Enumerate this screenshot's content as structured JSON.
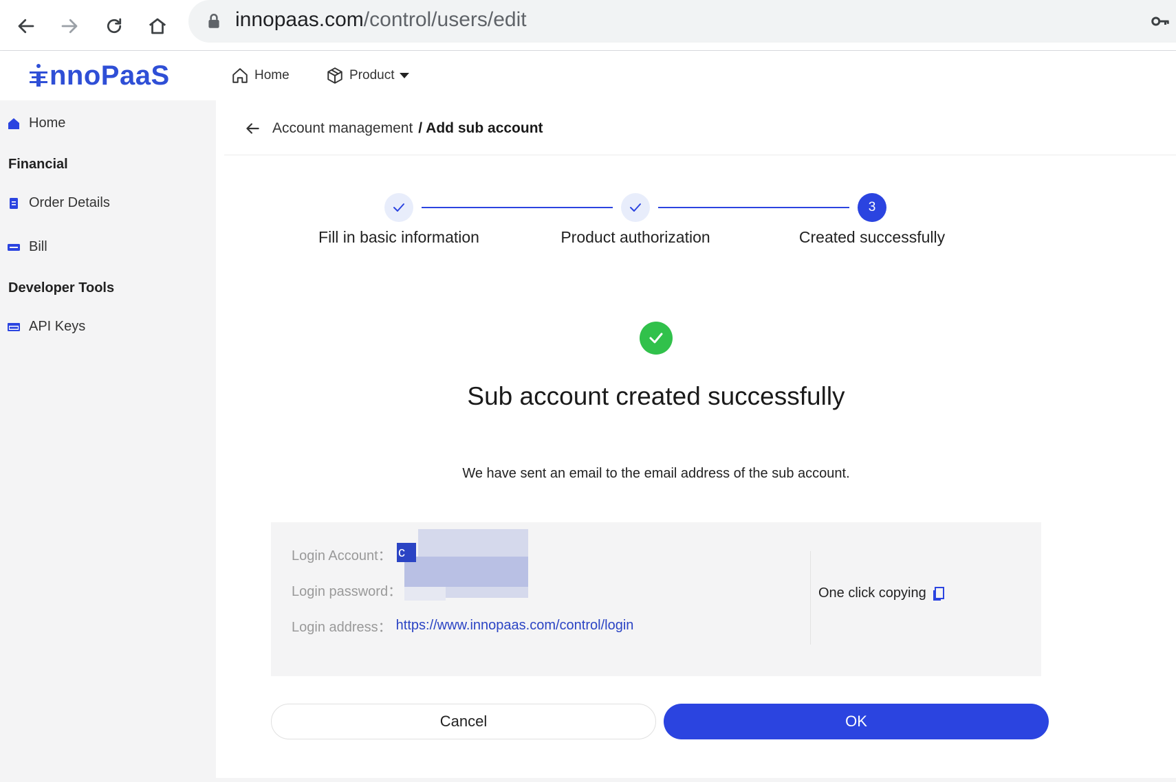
{
  "browser": {
    "url_host": "innopaas.com",
    "url_path": "/control/users/edit"
  },
  "header": {
    "logo_text": "nnoPaaS",
    "nav": [
      {
        "label": "Home",
        "icon": "home-icon"
      },
      {
        "label": "Product",
        "icon": "cube-icon"
      }
    ]
  },
  "sidebar": {
    "items": [
      {
        "label": "Home",
        "icon": "home-filled-icon"
      },
      {
        "group": "Financial"
      },
      {
        "label": "Order Details",
        "icon": "document-icon"
      },
      {
        "label": "Bill",
        "icon": "ticket-icon"
      },
      {
        "group": "Developer Tools"
      },
      {
        "label": "API Keys",
        "icon": "api-icon"
      }
    ]
  },
  "breadcrumb": {
    "parent": "Account management",
    "current": "/ Add sub account"
  },
  "steps": [
    {
      "label": "Fill in basic information",
      "status": "done"
    },
    {
      "label": "Product authorization",
      "status": "done"
    },
    {
      "label": "Created successfully",
      "status": "active",
      "number": "3"
    }
  ],
  "result": {
    "title": "Sub account created successfully",
    "description": "We have sent an email to the email address of the sub account."
  },
  "info": {
    "account_label": "Login Account：",
    "account_value": "c",
    "password_label": "Login password：",
    "address_label": "Login address：",
    "address_value": "https://www.innopaas.com/control/login",
    "copy_label": "One click copying"
  },
  "actions": {
    "cancel": "Cancel",
    "ok": "OK"
  },
  "colors": {
    "primary": "#2b44e0",
    "success": "#31c14b",
    "sidebar_bg": "#f4f4f5",
    "link": "#2b44c4"
  }
}
